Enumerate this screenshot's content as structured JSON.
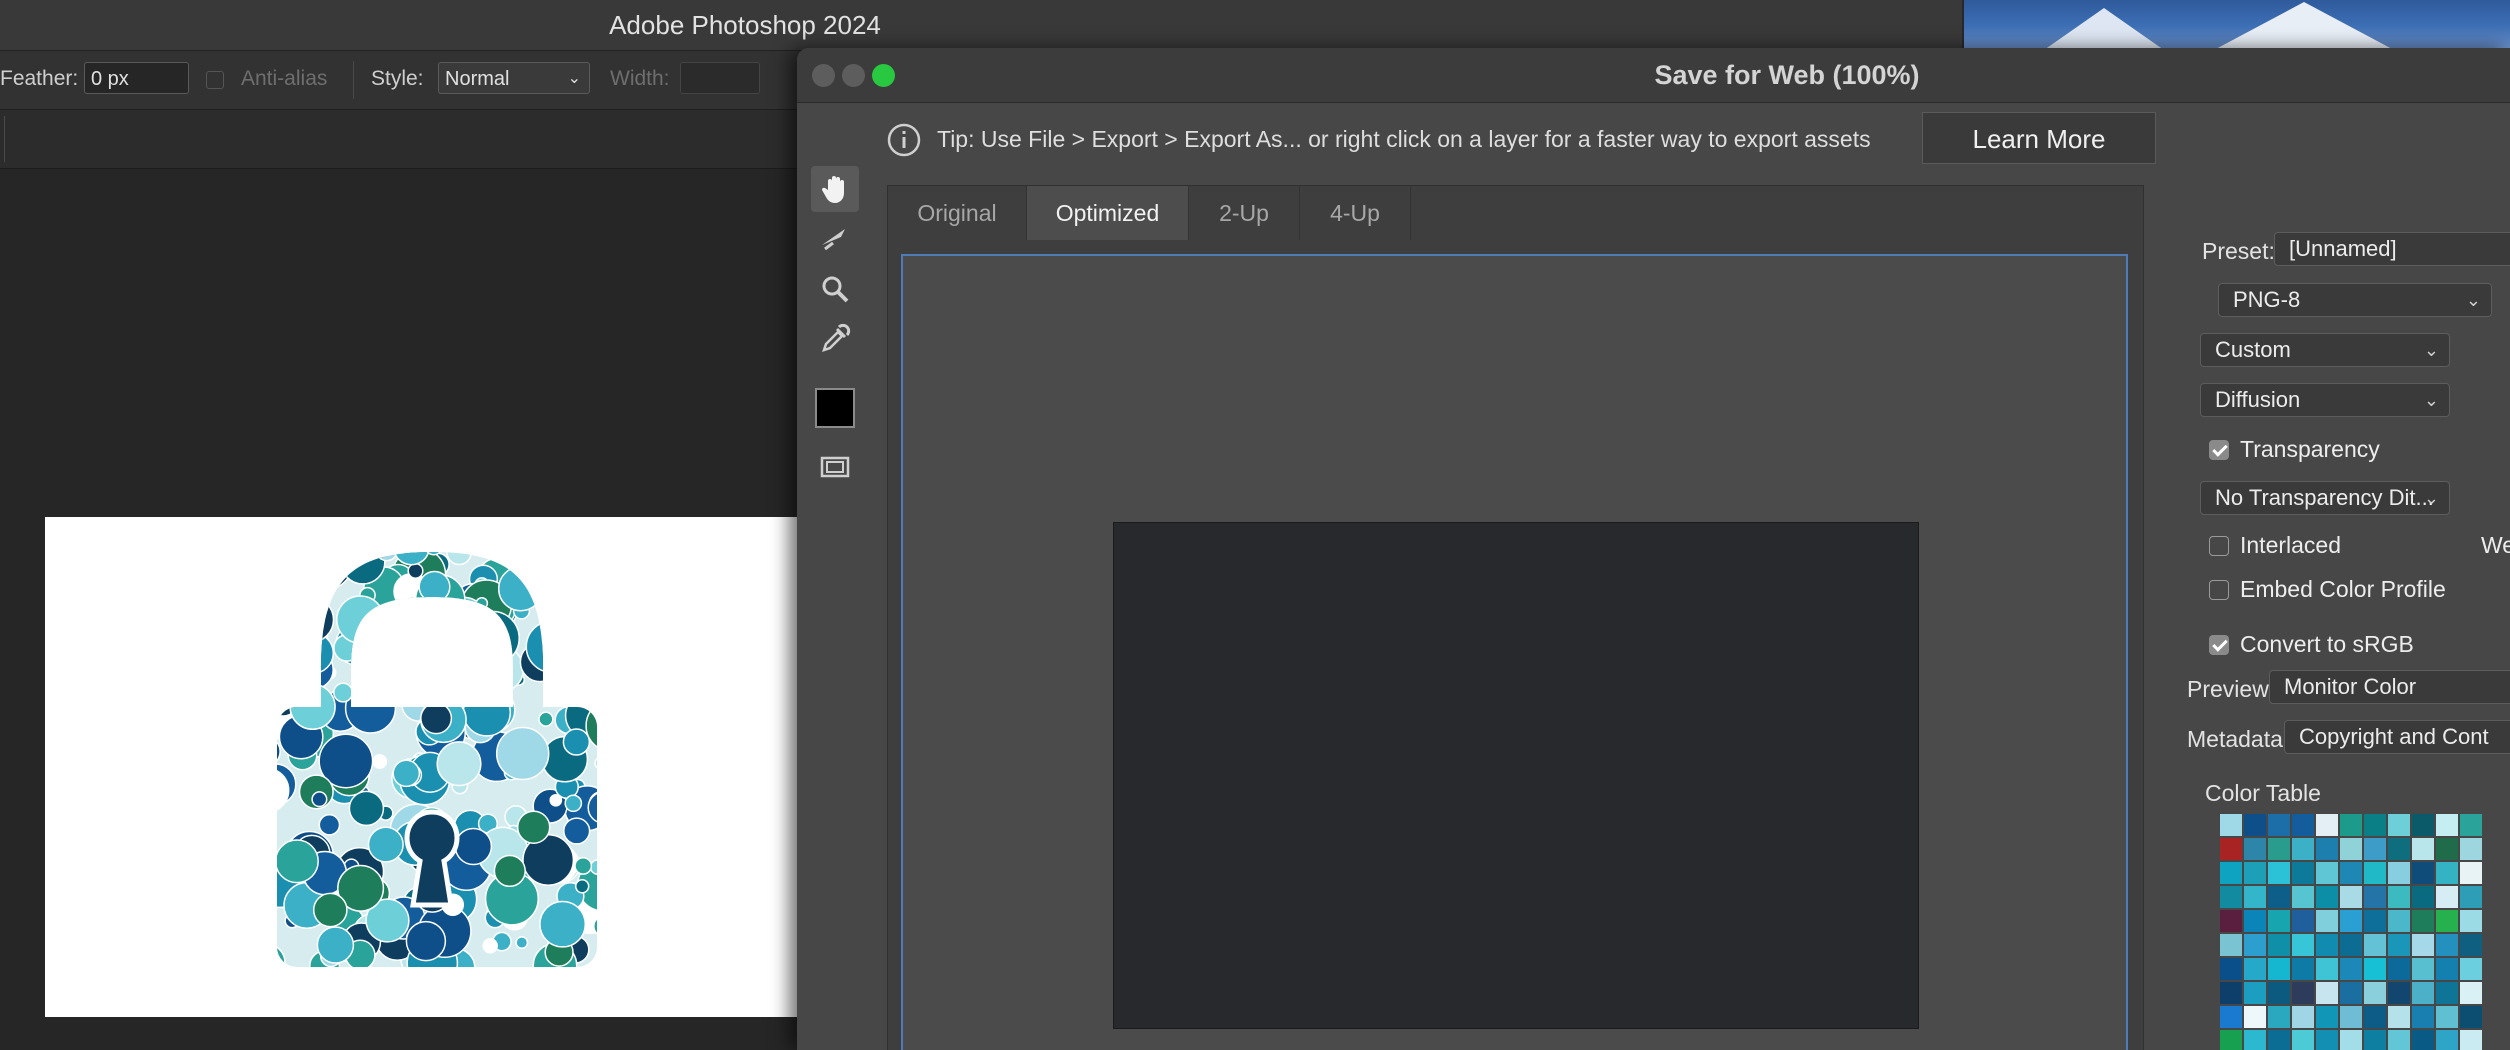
{
  "app": {
    "title": "Adobe Photoshop 2024"
  },
  "options_bar": {
    "feather_label": "Feather:",
    "feather_value": "0 px",
    "anti_alias_label": "Anti-alias",
    "style_label": "Style:",
    "style_value": "Normal",
    "width_label": "Width:",
    "width_value": ""
  },
  "dialog": {
    "title": "Save for Web (100%)",
    "tip": "Tip: Use File > Export > Export As...  or right click on a layer for a faster way to export assets",
    "learn_more": "Learn More",
    "tabs": [
      {
        "label": "Original",
        "active": false
      },
      {
        "label": "Optimized",
        "active": true
      },
      {
        "label": "2-Up",
        "active": false
      },
      {
        "label": "4-Up",
        "active": false
      }
    ],
    "foreground_color": "#000000",
    "traffic_colors": {
      "close": "#5d5d5d",
      "minimize": "#5d5d5d",
      "zoom": "#28c840"
    }
  },
  "settings": {
    "preset_label": "Preset:",
    "preset_value": "[Unnamed]",
    "format": "PNG-8",
    "reduction": "Custom",
    "dither": "Diffusion",
    "transparency_label": "Transparency",
    "transparency_checked": true,
    "transparency_dither": "No Transparency Dit...",
    "interlaced_label": "Interlaced",
    "interlaced_checked": false,
    "web_snap_partial": "We",
    "embed_label": "Embed Color Profile",
    "embed_checked": false,
    "srgb_label": "Convert to sRGB",
    "srgb_checked": true,
    "preview_label": "Preview:",
    "preview_value": "Monitor Color",
    "metadata_label": "Metadata:",
    "metadata_value": "Copyright and Cont",
    "color_table_label": "Color Table"
  },
  "color_table": [
    [
      "#9fd8e6",
      "#0e4f8a",
      "#1b6ea8",
      "#145d9c",
      "#e4eff5",
      "#1c9a8a",
      "#0b7f86",
      "#6dd0d8",
      "#0a5a6a",
      "#c5eef2",
      "#2aa39a"
    ],
    [
      "#a82424",
      "#2d86a8",
      "#2a9c8e",
      "#3bb0c6",
      "#1d7fae",
      "#8fd3d8",
      "#3d9cc8",
      "#0e6e7e",
      "#b8e6ea",
      "#1f6b4a",
      "#9ed6e0"
    ],
    [
      "#0fa3c2",
      "#1d9fb8",
      "#2bc1d6",
      "#0d7a9a",
      "#5fc6d6",
      "#1e87b4",
      "#20b9c8",
      "#87cfe0",
      "#0f4c7a",
      "#34b3c4",
      "#e8f3f6"
    ],
    [
      "#128aa0",
      "#33b6c9",
      "#0e5e8a",
      "#57c4d2",
      "#0c8fa6",
      "#a9dbe6",
      "#2474a8",
      "#3bbbc0",
      "#0a6a80",
      "#d6eef3",
      "#2d9eb6"
    ],
    [
      "#5a1f3e",
      "#0b84b8",
      "#17a6b0",
      "#1e5f9c",
      "#7fd0dc",
      "#2aa0d2",
      "#0d6f9a",
      "#4ab8c8",
      "#1e7d5a",
      "#26b14e",
      "#9adbe6"
    ],
    [
      "#7ac3d3",
      "#2c9fcf",
      "#0f8fa8",
      "#36c6d8",
      "#118bb0",
      "#0d6c92",
      "#63c2d6",
      "#1a97b8",
      "#a5d8e8",
      "#2390bd",
      "#0f5f80"
    ],
    [
      "#0b4f8a",
      "#26a8c8",
      "#14b6d0",
      "#0e7aa6",
      "#3ec4d4",
      "#1c88b8",
      "#17c0d4",
      "#0c6a9a",
      "#58bfd0",
      "#1480b0",
      "#6ccfe0"
    ],
    [
      "#0e3e6a",
      "#1b9ec0",
      "#0d5a80",
      "#2c3c5a",
      "#c6e5ee",
      "#1a6fa0",
      "#8acfdc",
      "#12466e",
      "#4cb0c8",
      "#0f7596",
      "#d9f0f4"
    ],
    [
      "#1a7ad0",
      "#eef8fb",
      "#2aa8c0",
      "#9fd5e4",
      "#1296b8",
      "#6ebdd4",
      "#0d5c88",
      "#b4e1ea",
      "#187fb0",
      "#5ec0d0",
      "#0c4d72"
    ],
    [
      "#16a050",
      "#2cb9cf",
      "#0b6c94",
      "#4ccbd6",
      "#138fb4",
      "#a2dde8",
      "#0e7fa0",
      "#62c6d6",
      "#0a5a86",
      "#2ea4c6",
      "#c9ebf1"
    ],
    [
      "#1478b8",
      "#36bcd0",
      "#9d6a8a",
      "#0f8cae",
      "#5ac8d8",
      "#1a72a6",
      "#83d2e0",
      "#0d6890",
      "#2a9fc4",
      "#b0dfe8",
      "#0c5a7e"
    ],
    [
      "#2a5f8e",
      "#1aa4c4",
      "#0d72a0",
      "#48c0d2",
      "#1387b4",
      "#a6dbe6",
      "#0f5e8c",
      "#3bb4ca",
      "#e0f2f6",
      "#2290be",
      "#2edff0"
    ]
  ]
}
